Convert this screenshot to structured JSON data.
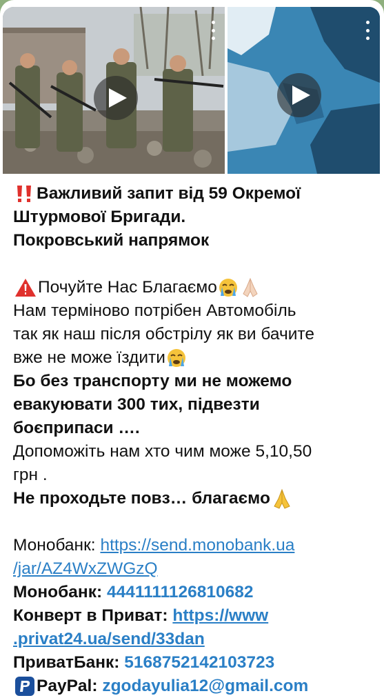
{
  "post": {
    "title_lines": [
      "Важливий запит від 59 Окремої",
      "Штурмової Бригади.",
      "Покровський  напрямок"
    ],
    "plea": "Почуйте Нас Благаємо",
    "body_lines": [
      "Нам терміново потрібен Автомобіль",
      "так як наш після обстрілу як ви бачите",
      "вже не може їздити"
    ],
    "bold_lines": [
      "Бо без транспорту ми не можемо",
      "евакуювати 300 тих, підвезти",
      "боєприпаси …."
    ],
    "help_lines": [
      "Допоможіть нам хто чим може 5,10,50",
      "грн ."
    ],
    "dont_pass": "Не проходьте повз… благаємо"
  },
  "donations": {
    "mono_label": "Монобанк:",
    "mono_link_line1": "https://send.monobank.ua",
    "mono_link_line2": "/jar/AZ4WxZWGzQ",
    "mono_card_label": "Монобанк:",
    "mono_card": "4441111126810682",
    "privat_label": "Конверт в Приват:",
    "privat_link_line1": "https://www",
    "privat_link_line2": ".privat24.ua/send/33dan",
    "privatbank_label": "ПриватБанк:",
    "privatbank_card": "5168752142103723",
    "paypal_label": "PayPal:",
    "paypal_email": "zgodayulia12@gmail.com"
  },
  "icons": {
    "double_exclamation": "double-exclamation-icon",
    "warning": "warning-icon",
    "crying_face": "crying-face-icon",
    "praying_hands": "praying-hands-icon",
    "paypal": "paypal-icon",
    "play": "play-icon",
    "more": "more-vertical-icon"
  },
  "colors": {
    "link": "#2a7fc6",
    "text": "#111111",
    "background": "#8fb07e"
  }
}
